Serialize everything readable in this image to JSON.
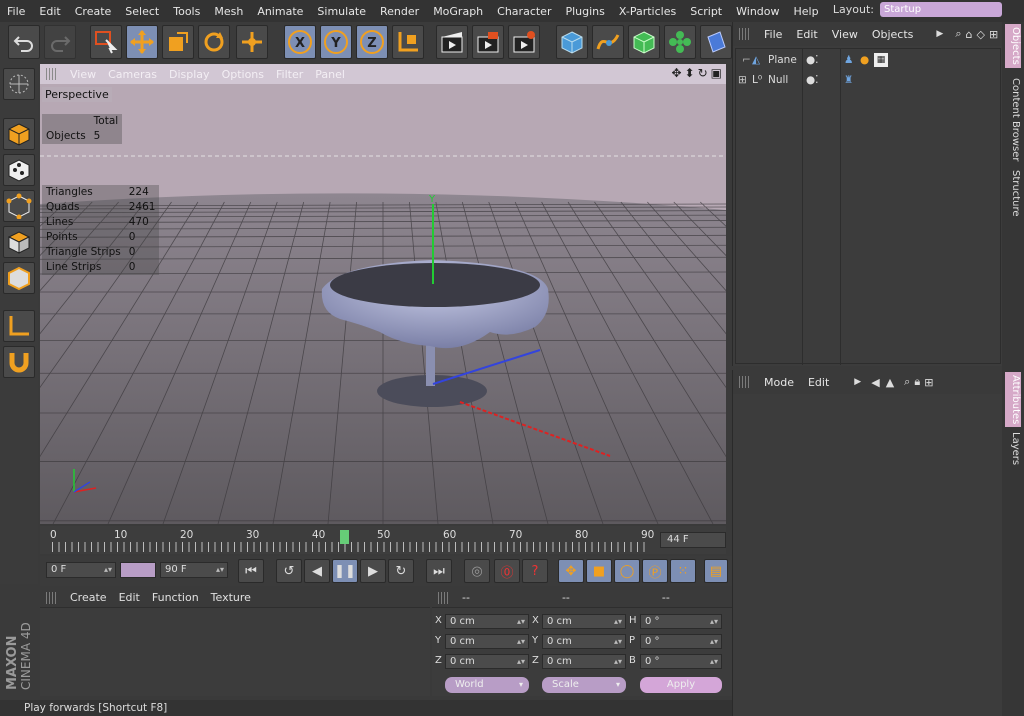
{
  "menubar": {
    "items": [
      "File",
      "Edit",
      "Create",
      "Select",
      "Tools",
      "Mesh",
      "Animate",
      "Simulate",
      "Render",
      "MoGraph",
      "Character",
      "Plugins",
      "X-Particles",
      "Script",
      "Window",
      "Help"
    ],
    "layout_label": "Layout:",
    "layout_value": "Startup"
  },
  "toolbar": {
    "icons": [
      "undo-icon",
      "redo-icon",
      "live-selection-icon",
      "move-icon",
      "scale-icon",
      "rotate-icon",
      "move-multi-icon",
      "x-axis-lock-icon",
      "y-axis-lock-icon",
      "z-axis-lock-icon",
      "coordinate-system-icon",
      "render-view-icon",
      "render-picture-viewer-icon",
      "edit-render-settings-icon",
      "cube-primitive-icon",
      "spline-icon",
      "subdivision-surface-icon",
      "cloner-icon",
      "deformer-icon"
    ],
    "axis_labels": [
      "X",
      "Y",
      "Z"
    ]
  },
  "left_toolbar": {
    "icons": [
      "make-editable-icon",
      "model-mode-icon",
      "texture-mode-icon",
      "points-mode-icon",
      "polygons-mode-icon",
      "axis-mode-icon",
      "magnet-icon"
    ]
  },
  "viewport": {
    "menu": [
      "View",
      "Cameras",
      "Display",
      "Options",
      "Filter",
      "Panel"
    ],
    "camera_label": "Perspective",
    "hud_total": {
      "header": "Total",
      "label": "Objects",
      "value": "5"
    },
    "hud_stats": [
      {
        "label": "Triangles",
        "value": "224"
      },
      {
        "label": "Quads",
        "value": "2461"
      },
      {
        "label": "Lines",
        "value": "470"
      },
      {
        "label": "Points",
        "value": "0"
      },
      {
        "label": "Triangle Strips",
        "value": "0"
      },
      {
        "label": "Line Strips",
        "value": "0"
      }
    ],
    "axis_y_label": "Y",
    "colors": {
      "background": "#b7a8b4",
      "floor": "#5e5a5f",
      "grid": "#3c393d",
      "cloth": "#9aa0c7",
      "y_axis": "#22cc33",
      "x_axis": "#dd2222",
      "z_axis": "#3344dd"
    }
  },
  "timeline": {
    "ticks": [
      "0",
      "10",
      "20",
      "30",
      "40",
      "50",
      "60",
      "70",
      "80",
      "90"
    ],
    "current_frame": "44 F",
    "current_frame_value": 44,
    "max_frame": 90
  },
  "transport": {
    "start_frame": "0 F",
    "end_frame": "90 F",
    "buttons": [
      "go-to-start-icon",
      "loop-back-icon",
      "step-back-icon",
      "pause-icon",
      "step-forward-icon",
      "loop-forward-icon",
      "go-to-end-icon",
      "record-icon",
      "autokey-icon",
      "keyframe-help-icon",
      "key-position-icon",
      "key-scale-icon",
      "key-rotation-icon",
      "key-parameter-icon",
      "key-pla-icon",
      "timeline-icon"
    ]
  },
  "material_panel": {
    "menu": [
      "Create",
      "Edit",
      "Function",
      "Texture"
    ]
  },
  "coordinates": {
    "headers": [
      "--",
      "--",
      "--"
    ],
    "rows": [
      {
        "pos_label": "X",
        "pos": "0 cm",
        "size_label": "X",
        "size": "0 cm",
        "rot_label": "H",
        "rot": "0 °"
      },
      {
        "pos_label": "Y",
        "pos": "0 cm",
        "size_label": "Y",
        "size": "0 cm",
        "rot_label": "P",
        "rot": "0 °"
      },
      {
        "pos_label": "Z",
        "pos": "0 cm",
        "size_label": "Z",
        "size": "0 cm",
        "rot_label": "B",
        "rot": "0 °"
      }
    ],
    "world": "World",
    "scale": "Scale",
    "apply": "Apply"
  },
  "objects_panel": {
    "menu": [
      "File",
      "Edit",
      "View",
      "Objects"
    ],
    "objects": [
      {
        "name": "Plane",
        "icon": "plane-object-icon"
      },
      {
        "name": "Null",
        "icon": "null-object-icon"
      }
    ]
  },
  "attributes_panel": {
    "menu": [
      "Mode",
      "Edit"
    ]
  },
  "right_tabs": {
    "top": [
      "Objects",
      "Content Browser",
      "Structure"
    ],
    "bottom": [
      "Attributes",
      "Layers"
    ]
  },
  "branding": {
    "line1": "MAXON",
    "line2": "CINEMA 4D"
  },
  "status": {
    "text": "Play forwards [Shortcut F8]"
  }
}
